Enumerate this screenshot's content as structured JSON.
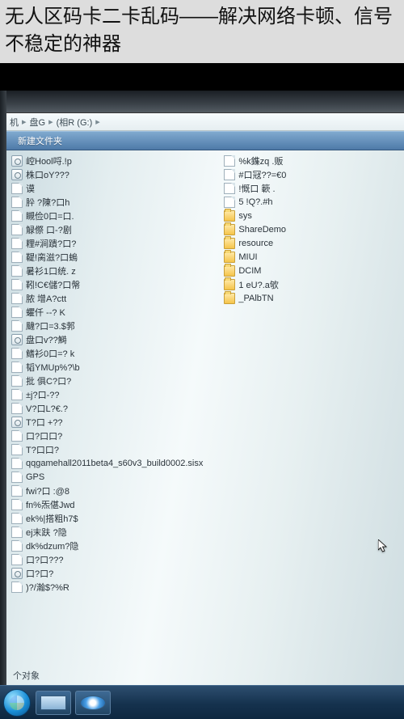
{
  "headline": "无人区码卡二卡乱码——解决网络卡顿、信号不稳定的神器",
  "crumbs": {
    "a": "机",
    "b": "盘G",
    "c": "(相R (G:)"
  },
  "toolbar": {
    "newFolder": "新建文件夹"
  },
  "footer": "个对象",
  "leftItems": [
    {
      "t": "set",
      "n": "崆Hool哷.!p"
    },
    {
      "t": "set",
      "n": "株口oY???"
    },
    {
      "t": "file",
      "n": "谟"
    },
    {
      "t": "file",
      "n": "肸 ?陳?口h"
    },
    {
      "t": "file",
      "n": "瞡俭0口=口."
    },
    {
      "t": "file",
      "n": "觮傺 口-?剧"
    },
    {
      "t": "file",
      "n": "粴#涧蹪?口?"
    },
    {
      "t": "file",
      "n": "鞮!脔滋?口螐"
    },
    {
      "t": "file",
      "n": "暑衫1口统.  z"
    },
    {
      "t": "file",
      "n": "靷!C€儲?口幋"
    },
    {
      "t": "file",
      "n": "脓  增A?ctt"
    },
    {
      "t": "file",
      "n": "蠷仟 --?  K"
    },
    {
      "t": "file",
      "n": "颹?口=3.$郣"
    },
    {
      "t": "set",
      "n": "盘口v??鰣"
    },
    {
      "t": "file",
      "n": "鳍衫0口=?  k"
    },
    {
      "t": "file",
      "n": "韬YMUp%?\\b"
    },
    {
      "t": "file",
      "n": "批  俱C?口?"
    },
    {
      "t": "file",
      "n": "±j?口-??"
    },
    {
      "t": "file",
      "n": "V?口L?€.?"
    },
    {
      "t": "set",
      "n": "T?口  +??"
    },
    {
      "t": "file",
      "n": "口?口口?"
    },
    {
      "t": "file",
      "n": "T?口口?"
    },
    {
      "t": "file",
      "n": "qqgamehall2011beta4_s60v3_build0002.sisx"
    },
    {
      "t": "file",
      "n": "GPS"
    },
    {
      "t": "file",
      "n": "fwi?口  :@8"
    },
    {
      "t": "file",
      "n": "fn%炁偡Jwd"
    },
    {
      "t": "file",
      "n": "ek%|搭粗h7$"
    },
    {
      "t": "file",
      "n": "ej末趺 ?隐"
    },
    {
      "t": "file",
      "n": "dk%dzum?隐"
    },
    {
      "t": "file",
      "n": "口?口???"
    },
    {
      "t": "set",
      "n": "口?口?"
    },
    {
      "t": "file",
      "n": ")?/瀚$?%R"
    }
  ],
  "rightItems": [
    {
      "t": "file",
      "n": "%k鏶zq .贩"
    },
    {
      "t": "file",
      "n": "#口冦??=€0"
    },
    {
      "t": "file",
      "n": "!慨口 簐 ."
    },
    {
      "t": "file",
      "n": "5  !Q?.#h"
    },
    {
      "t": "folder",
      "n": "sys"
    },
    {
      "t": "folder",
      "n": "ShareDemo"
    },
    {
      "t": "folder",
      "n": "resource"
    },
    {
      "t": "folder",
      "n": "MIUI"
    },
    {
      "t": "folder",
      "n": "DCIM"
    },
    {
      "t": "folder",
      "n": "1  eU?.a欨"
    },
    {
      "t": "folder",
      "n": "_PAlbTN"
    }
  ]
}
